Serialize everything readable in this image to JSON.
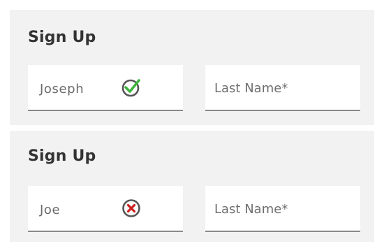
{
  "forms": [
    {
      "title": "Sign Up",
      "first_name_value": "Joseph",
      "last_name_placeholder": "Last Name*",
      "validation": "valid",
      "validation_icon": "check-circle-icon",
      "icon_color": "#3db53b"
    },
    {
      "title": "Sign Up",
      "first_name_value": "Joe",
      "last_name_placeholder": "Last Name*",
      "validation": "invalid",
      "validation_icon": "x-circle-icon",
      "icon_color": "#cc1f1f"
    }
  ]
}
